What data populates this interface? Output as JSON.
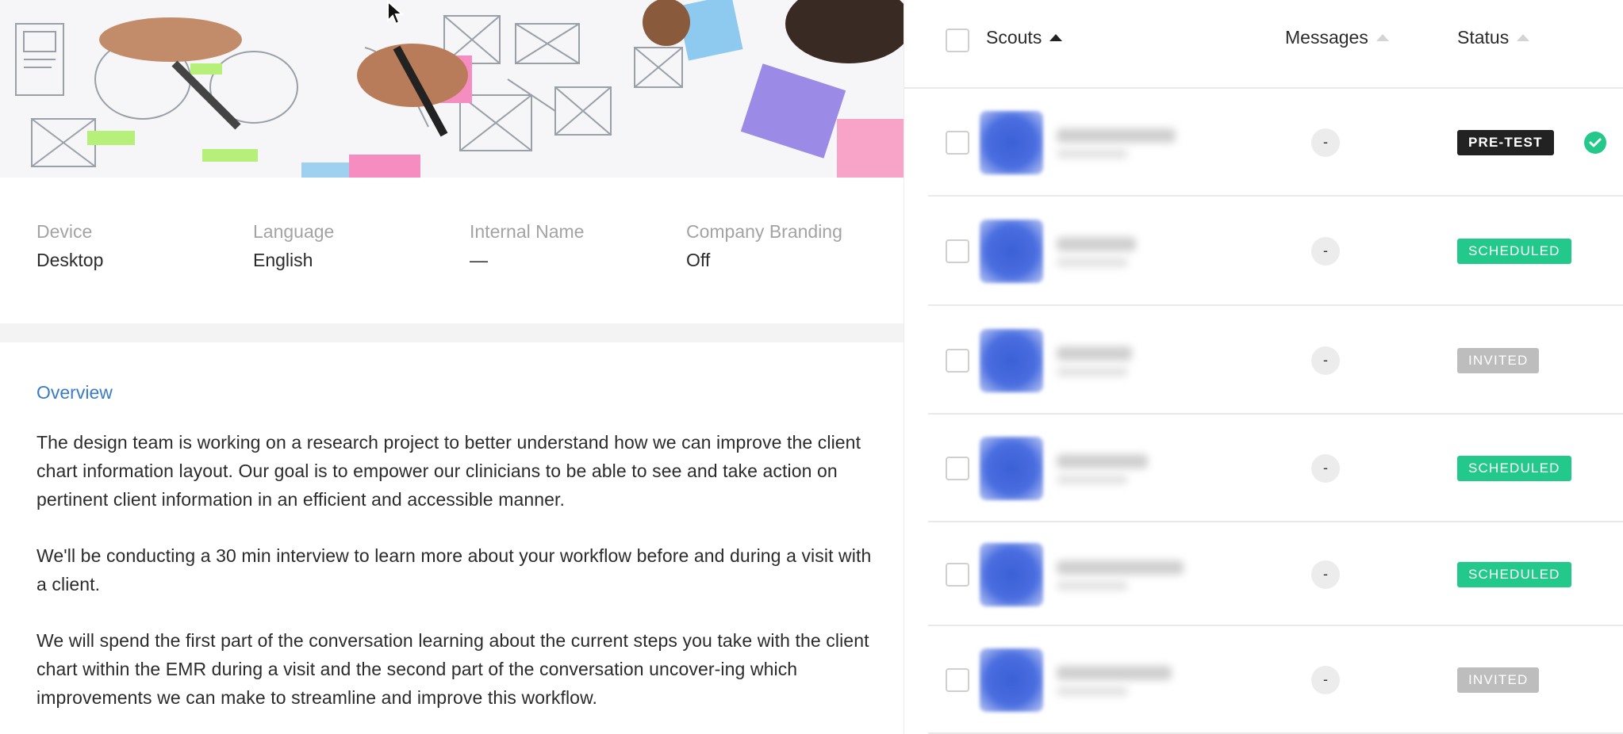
{
  "study": {
    "meta": [
      {
        "label": "Device",
        "value": "Desktop"
      },
      {
        "label": "Language",
        "value": "English"
      },
      {
        "label": "Internal Name",
        "value": "—"
      },
      {
        "label": "Company Branding",
        "value": "Off"
      }
    ],
    "overview_title": "Overview",
    "paragraphs": [
      "The design team is working on a research project to better understand how we can improve the client chart information layout. Our goal is to empower our clinicians to be able to see and take action on pertinent client information in an efficient and accessible manner.",
      "We'll be conducting a 30 min interview to learn more about your workflow before and during a visit with a client.",
      "We will spend the first part of the conversation learning about the current steps you take with the client chart within the EMR during a visit and the second part of the conversation uncover-ing which improvements we can make to streamline and improve this workflow."
    ]
  },
  "table": {
    "headers": {
      "scouts": "Scouts",
      "messages": "Messages",
      "status": "Status"
    },
    "rows": [
      {
        "messages": "-",
        "status": "PRE-TEST",
        "status_type": "pretest",
        "completed": true
      },
      {
        "messages": "-",
        "status": "SCHEDULED",
        "status_type": "scheduled",
        "completed": false
      },
      {
        "messages": "-",
        "status": "INVITED",
        "status_type": "invited",
        "completed": false
      },
      {
        "messages": "-",
        "status": "SCHEDULED",
        "status_type": "scheduled",
        "completed": false
      },
      {
        "messages": "-",
        "status": "SCHEDULED",
        "status_type": "scheduled",
        "completed": false
      },
      {
        "messages": "-",
        "status": "INVITED",
        "status_type": "invited",
        "completed": false
      }
    ]
  },
  "colors": {
    "accent_link": "#3a7bc8",
    "scheduled": "#22c98a",
    "invited": "#bdbdbd",
    "pretest": "#222222",
    "avatar": "#3b5fd6"
  },
  "icons": {
    "cursor": "mouse-pointer-icon",
    "sort": "sort-ascending-icon",
    "check": "check-circle-icon"
  }
}
